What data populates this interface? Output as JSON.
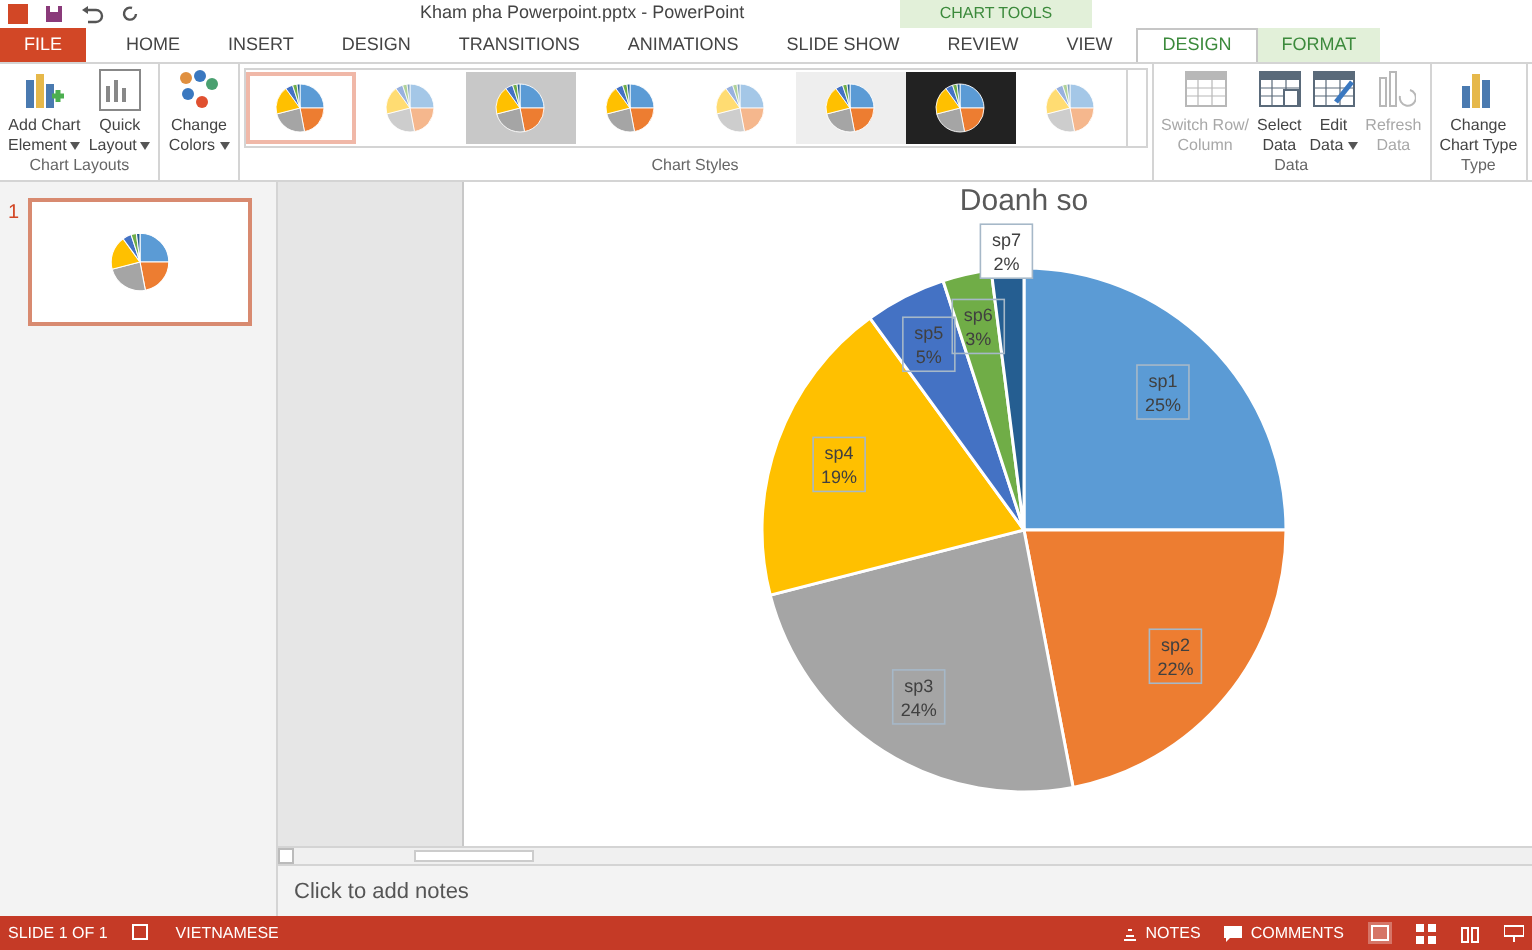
{
  "window": {
    "title": "Kham pha Powerpoint.pptx - PowerPoint"
  },
  "contextual_label": "CHART TOOLS",
  "tabs": [
    {
      "label": "FILE",
      "kind": "file",
      "selected": false
    },
    {
      "label": "HOME",
      "kind": "normal",
      "selected": false
    },
    {
      "label": "INSERT",
      "kind": "normal",
      "selected": false
    },
    {
      "label": "DESIGN",
      "kind": "normal",
      "selected": false
    },
    {
      "label": "TRANSITIONS",
      "kind": "normal",
      "selected": false
    },
    {
      "label": "ANIMATIONS",
      "kind": "normal",
      "selected": false
    },
    {
      "label": "SLIDE SHOW",
      "kind": "normal",
      "selected": false
    },
    {
      "label": "REVIEW",
      "kind": "normal",
      "selected": false
    },
    {
      "label": "VIEW",
      "kind": "normal",
      "selected": false
    },
    {
      "label": "DESIGN",
      "kind": "contextual",
      "selected": true
    },
    {
      "label": "FORMAT",
      "kind": "contextual",
      "selected": false
    }
  ],
  "ribbon": {
    "groups": [
      {
        "label": "Chart Layouts",
        "buttons": [
          {
            "lines": [
              "Add Chart",
              "Element"
            ],
            "kind": "add",
            "dropdown": true,
            "disabled": false
          },
          {
            "lines": [
              "Quick",
              "Layout"
            ],
            "kind": "layout",
            "dropdown": true,
            "disabled": false
          }
        ]
      },
      {
        "buttons": [
          {
            "lines": [
              "Change",
              "Colors"
            ],
            "kind": "colors",
            "dropdown": true,
            "disabled": false
          }
        ]
      },
      {
        "label": "Chart Styles",
        "gallery": [
          {
            "selected": true
          },
          {
            "selected": false
          },
          {
            "selected": false
          },
          {
            "selected": false
          },
          {
            "selected": false
          },
          {
            "selected": false
          },
          {
            "selected": false
          },
          {
            "selected": false
          }
        ]
      },
      {
        "label": "Data",
        "buttons": [
          {
            "lines": [
              "Switch Row/",
              "Column"
            ],
            "kind": "switch",
            "dropdown": false,
            "disabled": true
          },
          {
            "lines": [
              "Select",
              "Data"
            ],
            "kind": "select",
            "dropdown": false,
            "disabled": false
          },
          {
            "lines": [
              "Edit",
              "Data"
            ],
            "kind": "edit",
            "dropdown": true,
            "disabled": false
          },
          {
            "lines": [
              "Refresh",
              "Data"
            ],
            "kind": "refresh",
            "dropdown": false,
            "disabled": true
          }
        ]
      },
      {
        "label": "Type",
        "buttons": [
          {
            "lines": [
              "Change",
              "Chart Type"
            ],
            "kind": "type",
            "dropdown": false,
            "disabled": false
          }
        ]
      }
    ]
  },
  "slides": [
    {
      "number": "1",
      "selected": true
    }
  ],
  "slide": {
    "chart_data": {
      "type": "pie",
      "title": "Doanh so",
      "categories": [
        "sp1",
        "sp2",
        "sp3",
        "sp4",
        "sp5",
        "sp6",
        "sp7"
      ],
      "values": [
        25,
        22,
        24,
        19,
        5,
        3,
        2
      ],
      "colors": [
        "#5b9bd5",
        "#ed7d31",
        "#a5a5a5",
        "#ffc000",
        "#4472c4",
        "#70ad47",
        "#255e91"
      ],
      "value_labels": [
        "25%",
        "22%",
        "24%",
        "19%",
        "5%",
        "3%",
        "2%"
      ]
    }
  },
  "notes": {
    "placeholder": "Click to add notes"
  },
  "status_bar": {
    "slide": "SLIDE 1 OF 1",
    "language": "VIETNAMESE",
    "notes": "NOTES",
    "comments": "COMMENTS"
  }
}
